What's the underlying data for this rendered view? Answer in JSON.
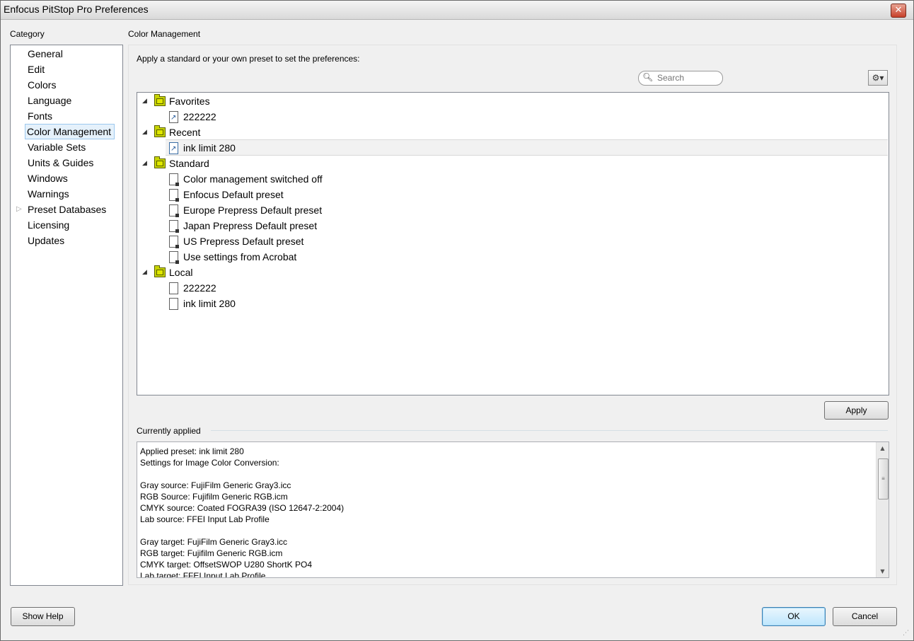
{
  "window": {
    "title": "Enfocus PitStop Pro Preferences",
    "close_glyph": "✕"
  },
  "category": {
    "label": "Category",
    "items": [
      {
        "label": "General"
      },
      {
        "label": "Edit"
      },
      {
        "label": "Colors"
      },
      {
        "label": "Language"
      },
      {
        "label": "Fonts"
      },
      {
        "label": "Color Management",
        "selected": true
      },
      {
        "label": "Variable Sets"
      },
      {
        "label": "Units & Guides"
      },
      {
        "label": "Windows"
      },
      {
        "label": "Warnings"
      },
      {
        "label": "Preset Databases",
        "expandable": true
      },
      {
        "label": "Licensing"
      },
      {
        "label": "Updates"
      }
    ]
  },
  "main": {
    "section_title": "Color Management",
    "prompt": "Apply a standard or your own preset to set the preferences:",
    "search": {
      "placeholder": "Search",
      "icon": "search-icon"
    },
    "gear_icon": "gear-icon",
    "tree": {
      "favorites": {
        "label": "Favorites",
        "items": [
          "222222"
        ]
      },
      "recent": {
        "label": "Recent",
        "items": [
          "ink limit 280"
        ]
      },
      "standard": {
        "label": "Standard",
        "items": [
          "Color management switched off",
          "Enfocus Default preset",
          "Europe Prepress Default preset",
          "Japan Prepress Default preset",
          "US Prepress Default preset",
          "Use settings from Acrobat"
        ]
      },
      "local": {
        "label": "Local",
        "items": [
          "222222",
          "ink limit 280"
        ]
      }
    },
    "apply_label": "Apply",
    "currently_applied": {
      "label": "Currently applied",
      "lines": [
        "Applied preset: ink limit 280",
        "Settings for Image Color Conversion:",
        "",
        "Gray source: FujiFilm Generic Gray3.icc",
        "RGB Source: Fujifilm Generic RGB.icm",
        "CMYK source: Coated FOGRA39 (ISO 12647-2:2004)",
        "Lab source: FFEI Input Lab Profile",
        "",
        "Gray target: FujiFilm Generic Gray3.icc",
        "RGB target: Fujifilm Generic RGB.icm",
        "CMYK target: OffsetSWOP U280 ShortK PO4",
        "Lab target: FFEI Input Lab Profile"
      ]
    }
  },
  "footer": {
    "help_label": "Show Help",
    "ok_label": "OK",
    "cancel_label": "Cancel"
  }
}
